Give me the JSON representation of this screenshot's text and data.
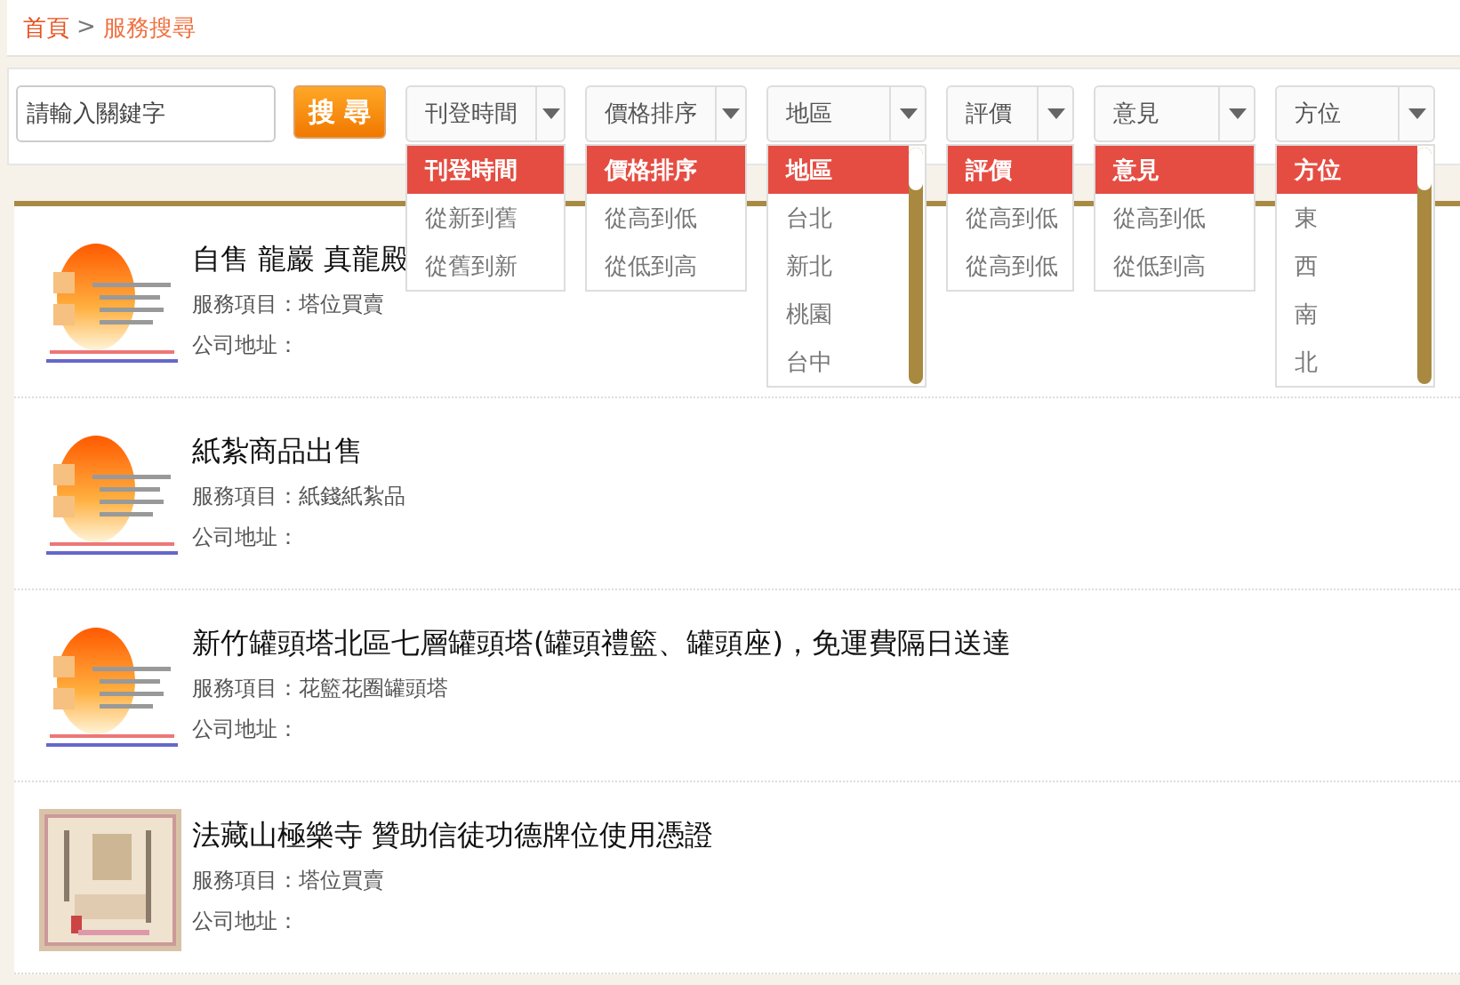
{
  "breadcrumb": [
    {
      "label": "首頁",
      "kind": "link"
    },
    {
      "label": ">",
      "kind": "separator"
    },
    {
      "label": "服務搜尋",
      "kind": "current"
    }
  ],
  "search": {
    "placeholder": "請輸入關鍵字",
    "button": "搜 尋"
  },
  "filters": [
    {
      "label": "刊登時間",
      "scrollable": false,
      "options": [
        {
          "label": "刊登時間",
          "selected": true
        },
        {
          "label": "從新到舊",
          "selected": false
        },
        {
          "label": "從舊到新",
          "selected": false
        }
      ]
    },
    {
      "label": "價格排序",
      "scrollable": false,
      "options": [
        {
          "label": "價格排序",
          "selected": true
        },
        {
          "label": "從高到低",
          "selected": false
        },
        {
          "label": "從低到高",
          "selected": false
        }
      ]
    },
    {
      "label": "地區",
      "scrollable": true,
      "options": [
        {
          "label": "地區",
          "selected": true
        },
        {
          "label": "台北",
          "selected": false
        },
        {
          "label": "新北",
          "selected": false
        },
        {
          "label": "桃園",
          "selected": false
        },
        {
          "label": "台中",
          "selected": false
        }
      ]
    },
    {
      "label": "評價",
      "scrollable": false,
      "options": [
        {
          "label": "評價",
          "selected": true
        },
        {
          "label": "從高到低",
          "selected": false
        },
        {
          "label": "從高到低",
          "selected": false
        }
      ]
    },
    {
      "label": "意見",
      "scrollable": false,
      "options": [
        {
          "label": "意見",
          "selected": true
        },
        {
          "label": "從高到低",
          "selected": false
        },
        {
          "label": "從低到高",
          "selected": false
        }
      ]
    },
    {
      "label": "方位",
      "scrollable": true,
      "options": [
        {
          "label": "方位",
          "selected": true
        },
        {
          "label": "東",
          "selected": false
        },
        {
          "label": "西",
          "selected": false
        },
        {
          "label": "南",
          "selected": false
        },
        {
          "label": "北",
          "selected": false
        }
      ]
    }
  ],
  "listings": [
    {
      "kind": "logo",
      "title": "自售 龍巖 真龍殿",
      "service": "服務項目：塔位買賣",
      "address": "公司地址："
    },
    {
      "kind": "logo",
      "title": "紙紮商品出售",
      "service": "服務項目：紙錢紙紮品",
      "address": "公司地址："
    },
    {
      "kind": "logo",
      "title": "新竹罐頭塔北區七層罐頭塔(罐頭禮籃、罐頭座)，免運費隔日送達",
      "service": "服務項目：花籃花圈罐頭塔",
      "address": "公司地址："
    },
    {
      "kind": "certificate",
      "title": "法藏山極樂寺 贊助信徒功德牌位使用憑證",
      "service": "服務項目：塔位買賣",
      "address": "公司地址："
    }
  ]
}
